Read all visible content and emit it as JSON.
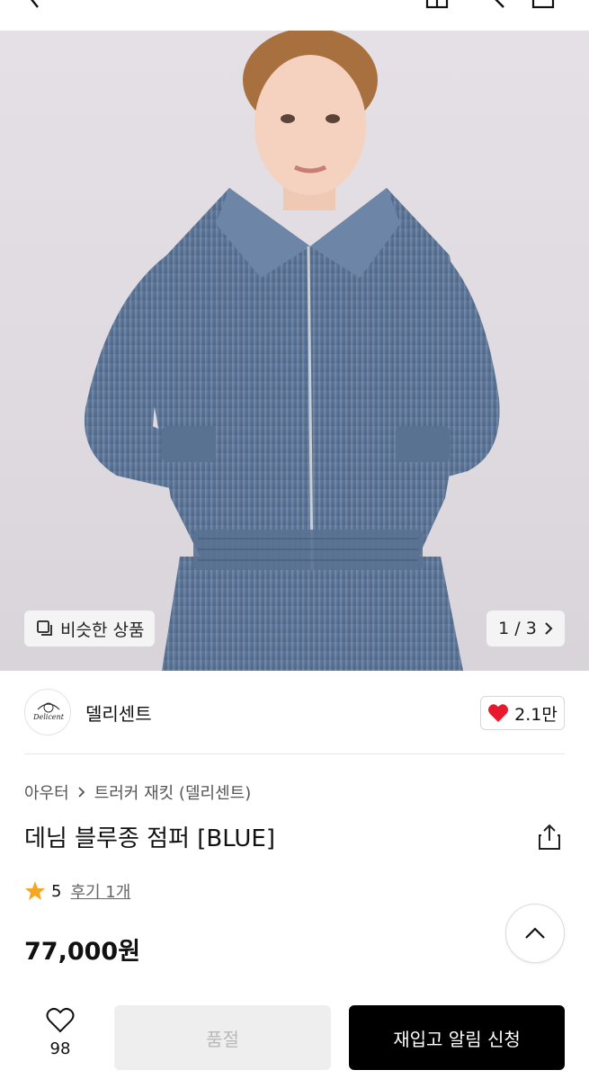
{
  "header": {
    "icons": [
      "back-icon",
      "store-icon",
      "search-icon",
      "cart-icon"
    ]
  },
  "gallery": {
    "similar_label": "비슷한 상품",
    "page_indicator": "1 / 3",
    "current_page": 1,
    "total_pages": 3
  },
  "brand": {
    "name": "델리센트",
    "logo_text": "Delicent",
    "likes": "2.1만"
  },
  "product": {
    "category": "아우터",
    "subcategory": "트러커 재킷 (델리센트)",
    "title": "데님 블루종 점퍼 [BLUE]",
    "rating": "5",
    "review_label": "후기 1개",
    "price": "77,000원"
  },
  "bottom_bar": {
    "wish_count": "98",
    "soldout_label": "품절",
    "restock_label": "재입고 알림 신청"
  },
  "colors": {
    "accent_black": "#000000",
    "heart_red": "#e8192c",
    "star_orange": "#f5a623",
    "disabled_bg": "#eeeeee",
    "denim": "#5f7898"
  }
}
